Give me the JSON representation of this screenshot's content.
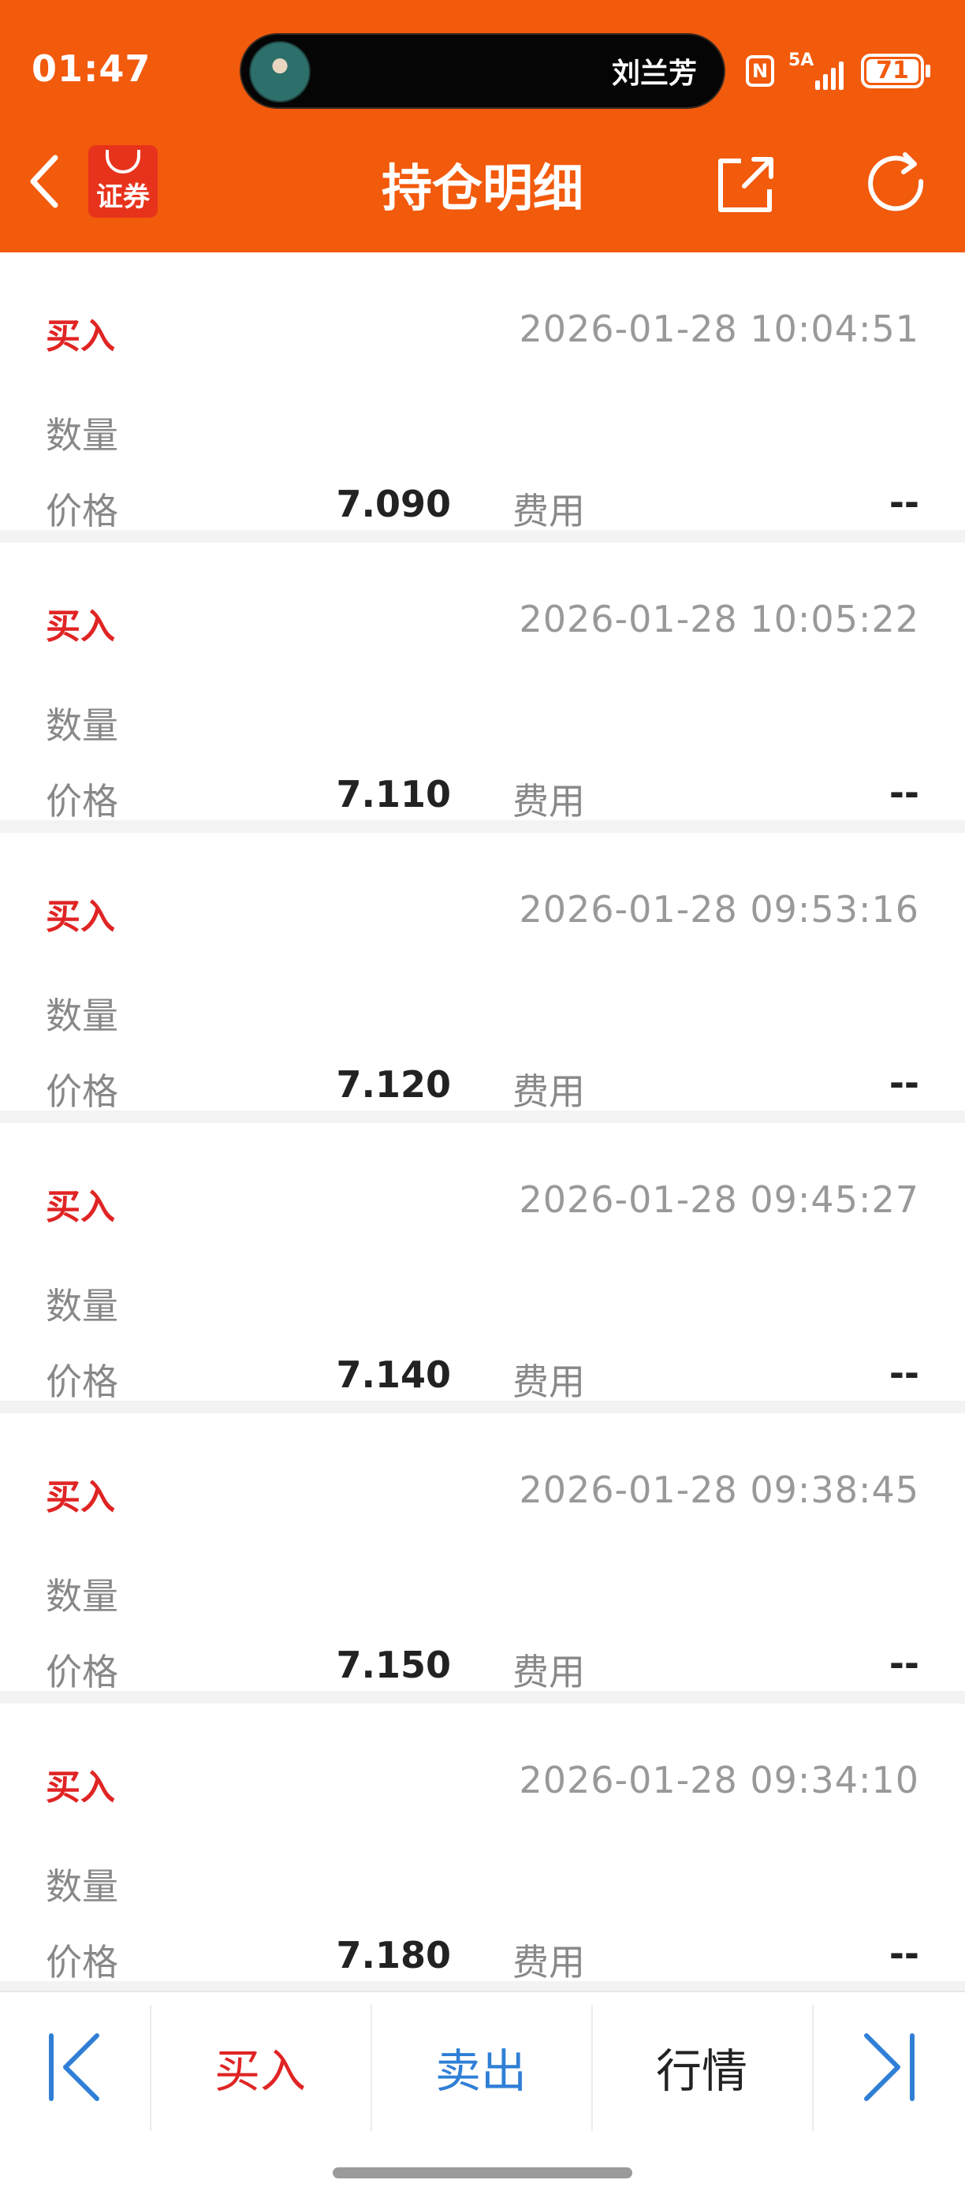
{
  "status_bar": {
    "time": "01:47",
    "live_pill_name": "刘兰芳",
    "network": "5A",
    "battery": "71",
    "battery_level": 0.71
  },
  "header": {
    "logo_text": "证券",
    "title": "持仓明细",
    "icons": [
      "back-icon",
      "share-icon",
      "refresh-icon"
    ],
    "bg_color": "#f25a0c"
  },
  "records": [
    {
      "type": "买入",
      "time": "2026-01-28 10:04:51",
      "qty_label": "数量",
      "price_label": "价格",
      "price": "7.090",
      "fee_label": "费用",
      "fee": "--"
    },
    {
      "type": "买入",
      "time": "2026-01-28 10:05:22",
      "qty_label": "数量",
      "price_label": "价格",
      "price": "7.110",
      "fee_label": "费用",
      "fee": "--"
    },
    {
      "type": "买入",
      "time": "2026-01-28 09:53:16",
      "qty_label": "数量",
      "price_label": "价格",
      "price": "7.120",
      "fee_label": "费用",
      "fee": "--"
    },
    {
      "type": "买入",
      "time": "2026-01-28 09:45:27",
      "qty_label": "数量",
      "price_label": "价格",
      "price": "7.140",
      "fee_label": "费用",
      "fee": "--"
    },
    {
      "type": "买入",
      "time": "2026-01-28 09:38:45",
      "qty_label": "数量",
      "price_label": "价格",
      "price": "7.150",
      "fee_label": "费用",
      "fee": "--"
    },
    {
      "type": "买入",
      "time": "2026-01-28 09:34:10",
      "qty_label": "数量",
      "price_label": "价格",
      "price": "7.180",
      "fee_label": "费用",
      "fee": "--"
    }
  ],
  "bottom_bar": {
    "buy": "买入",
    "sell": "卖出",
    "quote": "行情",
    "buy_color": "#e02424",
    "sell_color": "#2f7fd6"
  }
}
